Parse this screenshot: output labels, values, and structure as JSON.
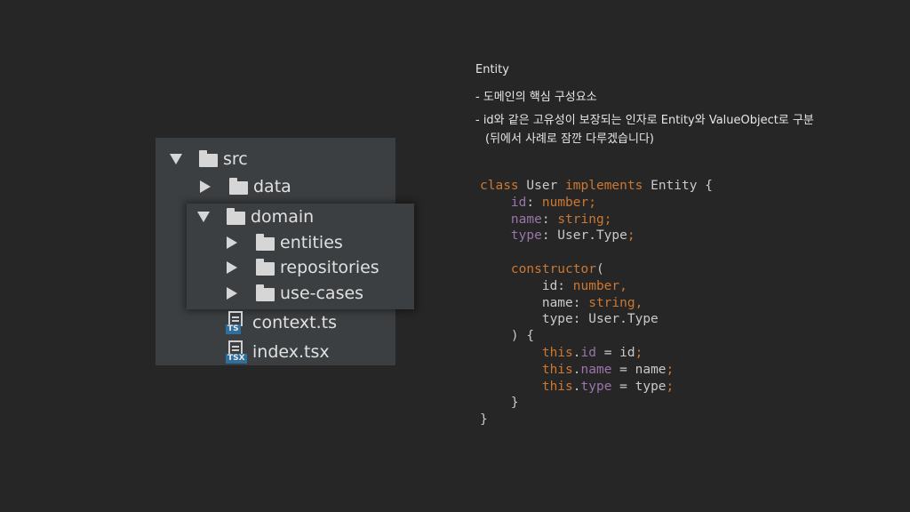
{
  "tree": {
    "items": [
      {
        "label": "src",
        "type": "folder",
        "state": "expanded"
      },
      {
        "label": "data",
        "type": "folder",
        "state": "collapsed"
      },
      {
        "label": "domain",
        "type": "folder",
        "state": "expanded"
      },
      {
        "label": "entities",
        "type": "folder",
        "state": "collapsed"
      },
      {
        "label": "repositories",
        "type": "folder",
        "state": "collapsed"
      },
      {
        "label": "use-cases",
        "type": "folder",
        "state": "collapsed"
      },
      {
        "label": "context.ts",
        "type": "file",
        "badge": "TS"
      },
      {
        "label": "index.tsx",
        "type": "file",
        "badge": "TSX"
      }
    ]
  },
  "notes": {
    "title": "Entity",
    "bullet1": "-  도메인의 핵심 구성요소",
    "bullet2": "-  id와 같은 고유성이 보장되는 인자로 Entity와 ValueObject로 구분",
    "bullet2_cont": "(뒤에서 사례로 잠깐 다루겠습니다)"
  },
  "code": {
    "lines": [
      [
        {
          "t": "class",
          "c": "kw"
        },
        {
          "t": " User ",
          "c": "pl"
        },
        {
          "t": "implements",
          "c": "kw"
        },
        {
          "t": " Entity {",
          "c": "pl"
        }
      ],
      [
        {
          "t": "    ",
          "c": "pl"
        },
        {
          "t": "id",
          "c": "pr"
        },
        {
          "t": ": ",
          "c": "pl"
        },
        {
          "t": "number;",
          "c": "kw"
        }
      ],
      [
        {
          "t": "    ",
          "c": "pl"
        },
        {
          "t": "name",
          "c": "pr"
        },
        {
          "t": ": ",
          "c": "pl"
        },
        {
          "t": "string;",
          "c": "kw"
        }
      ],
      [
        {
          "t": "    ",
          "c": "pl"
        },
        {
          "t": "type",
          "c": "pr"
        },
        {
          "t": ": User.Type",
          "c": "pl"
        },
        {
          "t": ";",
          "c": "kw"
        }
      ],
      [],
      [
        {
          "t": "    ",
          "c": "pl"
        },
        {
          "t": "constructor",
          "c": "kw"
        },
        {
          "t": "(",
          "c": "pl"
        }
      ],
      [
        {
          "t": "        id: ",
          "c": "pl"
        },
        {
          "t": "number,",
          "c": "kw"
        }
      ],
      [
        {
          "t": "        name: ",
          "c": "pl"
        },
        {
          "t": "string,",
          "c": "kw"
        }
      ],
      [
        {
          "t": "        type: User.Type",
          "c": "pl"
        }
      ],
      [
        {
          "t": "    ) {",
          "c": "pl"
        }
      ],
      [
        {
          "t": "        ",
          "c": "pl"
        },
        {
          "t": "this",
          "c": "kw"
        },
        {
          "t": ".",
          "c": "pl"
        },
        {
          "t": "id",
          "c": "pr"
        },
        {
          "t": " = id",
          "c": "pl"
        },
        {
          "t": ";",
          "c": "kw"
        }
      ],
      [
        {
          "t": "        ",
          "c": "pl"
        },
        {
          "t": "this",
          "c": "kw"
        },
        {
          "t": ".",
          "c": "pl"
        },
        {
          "t": "name",
          "c": "pr"
        },
        {
          "t": " = name",
          "c": "pl"
        },
        {
          "t": ";",
          "c": "kw"
        }
      ],
      [
        {
          "t": "        ",
          "c": "pl"
        },
        {
          "t": "this",
          "c": "kw"
        },
        {
          "t": ".",
          "c": "pl"
        },
        {
          "t": "type",
          "c": "pr"
        },
        {
          "t": " = type",
          "c": "pl"
        },
        {
          "t": ";",
          "c": "kw"
        }
      ],
      [
        {
          "t": "    }",
          "c": "pl"
        }
      ],
      [
        {
          "t": "}",
          "c": "pl"
        }
      ]
    ]
  },
  "colors": {
    "background": "#262626",
    "panel": "#3c3f41",
    "keyword": "#cc7832",
    "property": "#9876aa",
    "plain": "#c9c9c9",
    "ts_badge": "#2f6f9c"
  }
}
